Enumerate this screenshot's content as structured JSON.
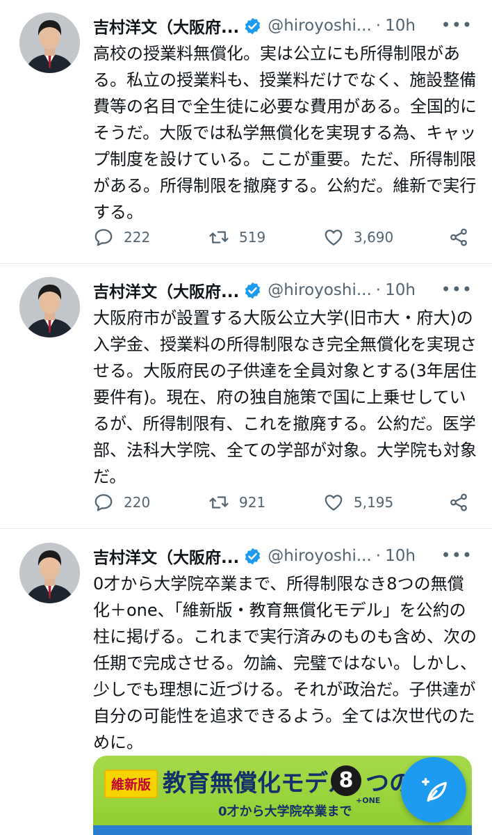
{
  "tweets": [
    {
      "name": "吉村洋文（大阪府...",
      "handle": "@hiroyoshi...",
      "dot": "·",
      "time": "10h",
      "more": "•••",
      "text": "高校の授業料無償化。実は公立にも所得制限がある。私立の授業料も、授業料だけでなく、施設整備費等の名目で全生徒に必要な費用がある。全国的にそうだ。大阪では私学無償化を実現する為、キャップ制度を設けている。ここが重要。ただ、所得制限がある。所得制限を撤廃する。公約だ。維新で実行する。",
      "replies": "222",
      "retweets": "519",
      "likes": "3,690"
    },
    {
      "name": "吉村洋文（大阪府...",
      "handle": "@hiroyoshi...",
      "dot": "·",
      "time": "10h",
      "more": "•••",
      "text": "大阪府市が設置する大阪公立大学(旧市大・府大)の入学金、授業料の所得制限なき完全無償化を実現させる。大阪府民の子供達を全員対象とする(3年居住要件有)。現在、府の独自施策で国に上乗せしているが、所得制限有、これを撤廃する。公約だ。医学部、法科大学院、全ての学部が対象。大学院も対象だ。",
      "replies": "220",
      "retweets": "921",
      "likes": "5,195"
    },
    {
      "name": "吉村洋文（大阪府...",
      "handle": "@hiroyoshi...",
      "dot": "·",
      "time": "10h",
      "more": "•••",
      "text": "0才から大学院卒業まで、所得制限なき8つの無償化＋one、「維新版・教育無償化モデル」を公約の柱に掲げる。これまで実行済みのものも含め、次の任期で完成させる。勿論、完璧ではない。しかし、少しでも理想に近づける。それが政治だ。子供達が自分の可能性を追求できるよう。全ては次世代のために。"
    }
  ],
  "card": {
    "badge": "維新版",
    "title": "教育無償化モデル",
    "number": "8",
    "suffix": "つの無",
    "plus_one": "+ONE",
    "subtitle": "0才から大学院卒業まで"
  },
  "colors": {
    "accent": "#1d9bf0",
    "secondary_text": "#536471",
    "card_green": "#9bd33c",
    "card_navy": "#12306a"
  },
  "icons": {
    "reply": "reply-icon",
    "retweet": "retweet-icon",
    "like": "like-icon",
    "share": "share-icon",
    "compose": "compose-tweet-icon",
    "verified": "verified-badge-icon"
  }
}
